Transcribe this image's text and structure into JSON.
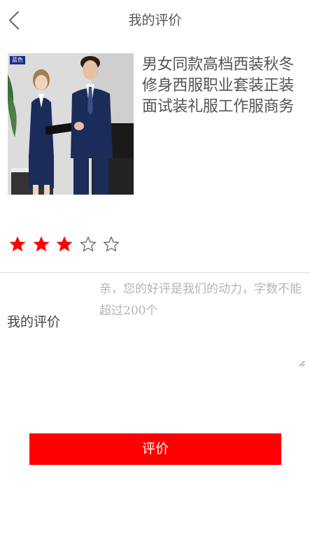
{
  "header": {
    "title": "我的评价",
    "back_icon": "chevron-left-icon"
  },
  "product": {
    "title": "男女同款高档西装秋冬修身西服职业套装正装面试装礼服工作服商务",
    "color_tag": "蓝色",
    "image_alt": "product-photo"
  },
  "rating": {
    "value": 3,
    "max": 5,
    "filled_color": "#ff0000",
    "empty_color": "#666666"
  },
  "review": {
    "label": "我的评价",
    "placeholder": "亲，您的好评是我们的动力，字数不能超过200个",
    "value": ""
  },
  "submit": {
    "label": "评价",
    "color": "#ff0000"
  }
}
